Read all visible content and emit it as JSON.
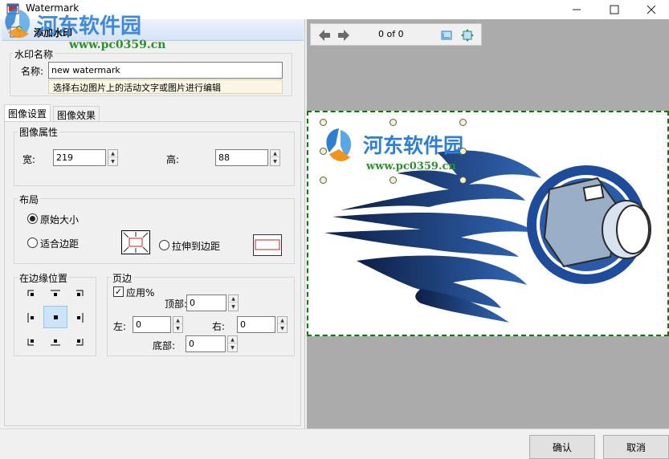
{
  "window": {
    "title": "Watermark",
    "minimize": "—",
    "maximize": "☐",
    "close": "✕"
  },
  "overlay": {
    "site_name": "河东软件园",
    "site_url": "www.pc0359.cn"
  },
  "header": {
    "add_watermark": "添加水印"
  },
  "name_group": {
    "title": "水印名称",
    "name_label": "名称:",
    "name_value": "new watermark",
    "hint": "选择右边图片上的活动文字或图片进行编辑"
  },
  "tabs": [
    {
      "label": "图像设置",
      "active": true
    },
    {
      "label": "图像效果",
      "active": false
    }
  ],
  "image_props": {
    "title": "图像属性",
    "width_label": "宽:",
    "width_value": "219",
    "height_label": "高:",
    "height_value": "88"
  },
  "layout": {
    "title": "布局",
    "options": [
      "原始大小",
      "适合边距",
      "拉伸到边距"
    ],
    "selected": "原始大小"
  },
  "edge_position": {
    "title": "在边缘位置",
    "selected": "center"
  },
  "margins": {
    "title": "页边",
    "apply_percent": "应用%",
    "apply_checked": true,
    "top_label": "顶部:",
    "top_value": "0",
    "left_label": "左:",
    "left_value": "0",
    "right_label": "右:",
    "right_value": "0",
    "bottom_label": "底部:",
    "bottom_value": "0"
  },
  "preview": {
    "page_counter": "0 of 0"
  },
  "buttons": {
    "ok": "确认",
    "cancel": "取消"
  },
  "colors": {
    "accent_green": "#0a7a0a",
    "flame_blue": "#1b3f86",
    "highlight": "#cde3f8"
  }
}
